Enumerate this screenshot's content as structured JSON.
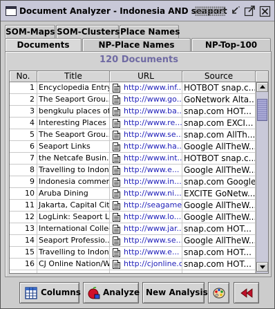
{
  "window": {
    "title": "Document Analyzer - Indonesia AND seaport",
    "icons": [
      "app-window-icon",
      "minimize-icon",
      "maximize-icon",
      "close-icon"
    ]
  },
  "tabs": {
    "row1": [
      "SOM-Maps",
      "SOM-Clusters",
      "Place Names"
    ],
    "row2": [
      "Documents",
      "NP-Place Names",
      "NP-Top-100"
    ],
    "active": "Documents"
  },
  "document_count": "120 Documents",
  "table": {
    "columns": [
      "No.",
      "Title",
      "URL",
      "Source"
    ],
    "rows": [
      {
        "no": "1",
        "title": "Encyclopedia Entry",
        "url": "http://www.inf...",
        "source": "HOTBOT snap.c..."
      },
      {
        "no": "2",
        "title": "The Seaport Grou...",
        "url": "http://www.go...",
        "source": "GoNetwork Alta..."
      },
      {
        "no": "3",
        "title": "bengkulu places of...",
        "url": "http://www.ba...",
        "source": "snap.com HOT..."
      },
      {
        "no": "4",
        "title": "Interesting Places ...",
        "url": "http://www.re...",
        "source": "snap.com EXCI..."
      },
      {
        "no": "5",
        "title": "The Seaport Grou...",
        "url": "http://www.se...",
        "source": "snap.com AllTh..."
      },
      {
        "no": "6",
        "title": "Seaport Links",
        "url": "http://www.ha...",
        "source": "Google AllTheW..."
      },
      {
        "no": "7",
        "title": "the Netcafe Busin...",
        "url": "http://www.int...",
        "source": "HOTBOT snap.c..."
      },
      {
        "no": "8",
        "title": "Travelling to Indon...",
        "url": "http://www.e...",
        "source": "Google AllTheW..."
      },
      {
        "no": "9",
        "title": "Indonesia commer...",
        "url": "http://www.in...",
        "source": "snap.com Google"
      },
      {
        "no": "10",
        "title": "Aruba Dining",
        "url": "http://www.ni...",
        "source": "EXCITE GoNetw..."
      },
      {
        "no": "11",
        "title": "Jakarta, Capital Cit...",
        "url": "http://seagame...",
        "source": "Google AllTheW..."
      },
      {
        "no": "12",
        "title": "LogLink: Seaport L...",
        "url": "http://www.lo...",
        "source": "Google AllTheW..."
      },
      {
        "no": "13",
        "title": "International Colleg...",
        "url": "http://www.jar...",
        "source": "snap.com HOT..."
      },
      {
        "no": "14",
        "title": "Seaport Professio...",
        "url": "http://www.se...",
        "source": "Google AllTheW..."
      },
      {
        "no": "15",
        "title": "Travelling to Indon...",
        "url": "http://www.e...",
        "source": "snap.com HOT..."
      },
      {
        "no": "16",
        "title": "CJ Online Nation/W...",
        "url": "http://cjonline.c...",
        "source": "snap.com HOT..."
      },
      {
        "no": "",
        "title": "",
        "url": "",
        "source": ""
      }
    ],
    "scroll_position": 0.04
  },
  "buttons": {
    "columns": "Columns",
    "analyze": "Analyze",
    "new_analysis": "New Analysis",
    "icons": [
      "columns-grid-icon",
      "analyze-apple-icon",
      "palette-icon",
      "back-arrows-icon"
    ]
  },
  "colors": {
    "count_text": "#6f6aa3",
    "url_text": "#1d1db8",
    "scroll_thumb": "#a9a9d6",
    "back_arrows": "#c0102a"
  }
}
